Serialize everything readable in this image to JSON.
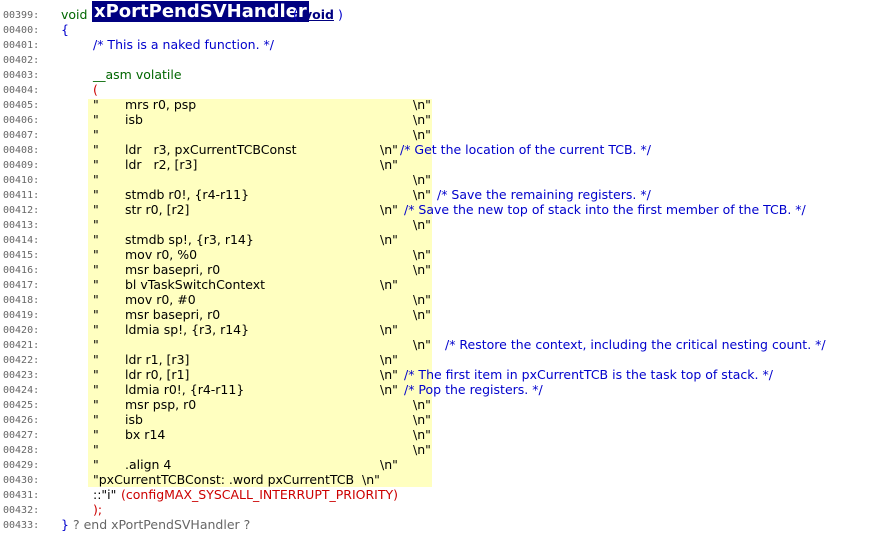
{
  "header": {
    "line_no": "00399:",
    "return_type": "void",
    "func_name": "xPortPendSVHandler",
    "paren_open": "(",
    "param_type": "void",
    "paren_close": ")"
  },
  "line_numbers": [
    "00400:",
    "00401:",
    "00402:",
    "00403:",
    "00404:",
    "00405:",
    "00406:",
    "00407:",
    "00408:",
    "00409:",
    "00410:",
    "00411:",
    "00412:",
    "00413:",
    "00414:",
    "00415:",
    "00416:",
    "00417:",
    "00418:",
    "00419:",
    "00420:",
    "00421:",
    "00422:",
    "00423:",
    "00424:",
    "00425:",
    "00426:",
    "00427:",
    "00428:",
    "00429:",
    "00430:",
    "00431:",
    "00432:",
    "00433:"
  ],
  "code": {
    "brace_open": "{",
    "naked_comment": "/* This is a naked function. */",
    "asm": "__asm volatile",
    "paren_open": "(",
    "q": "\"",
    "nl": "\\n\"",
    "asm_lines": [
      "mrs r0, psp",
      "isb",
      "",
      "ldr   r3, pxCurrentTCBConst",
      "ldr   r2, [r3]",
      "",
      "stmdb r0!, {r4-r11}",
      "str r0, [r2]",
      "",
      "stmdb sp!, {r3, r14}",
      "mov r0, %0",
      "msr basepri, r0",
      "bl vTaskSwitchContext",
      "mov r0, #0",
      "msr basepri, r0",
      "ldmia sp!, {r3, r14}",
      "",
      "ldr r1, [r3]",
      "ldr r0, [r1]",
      "ldmia r0!, {r4-r11}",
      "msr psp, r0",
      "isb",
      "bx r14",
      "",
      ".align 4"
    ],
    "comments": {
      "get_location": "/* Get the location of the current TCB. */",
      "save_regs": "/* Save the remaining registers. */",
      "save_top": "/* Save the new top of stack into the first member of the TCB. */",
      "restore": "/* Restore the context, including the critical nesting count. */",
      "first_item": "/* The first item in pxCurrentTCB is the task top of stack. */",
      "pop": "/* Pop the registers. */"
    },
    "tcb_const_line": "\"pxCurrentTCBConst: .word pxCurrentTCB  \\n\"",
    "constraint_prefix": "::\"i\"",
    "constraint_arg": "(configMAX_SYSCALL_INTERRUPT_PRIORITY)",
    "close_stmt": ");",
    "brace_close": "}",
    "end_marker": "? end xPortPendSVHandler ?"
  }
}
